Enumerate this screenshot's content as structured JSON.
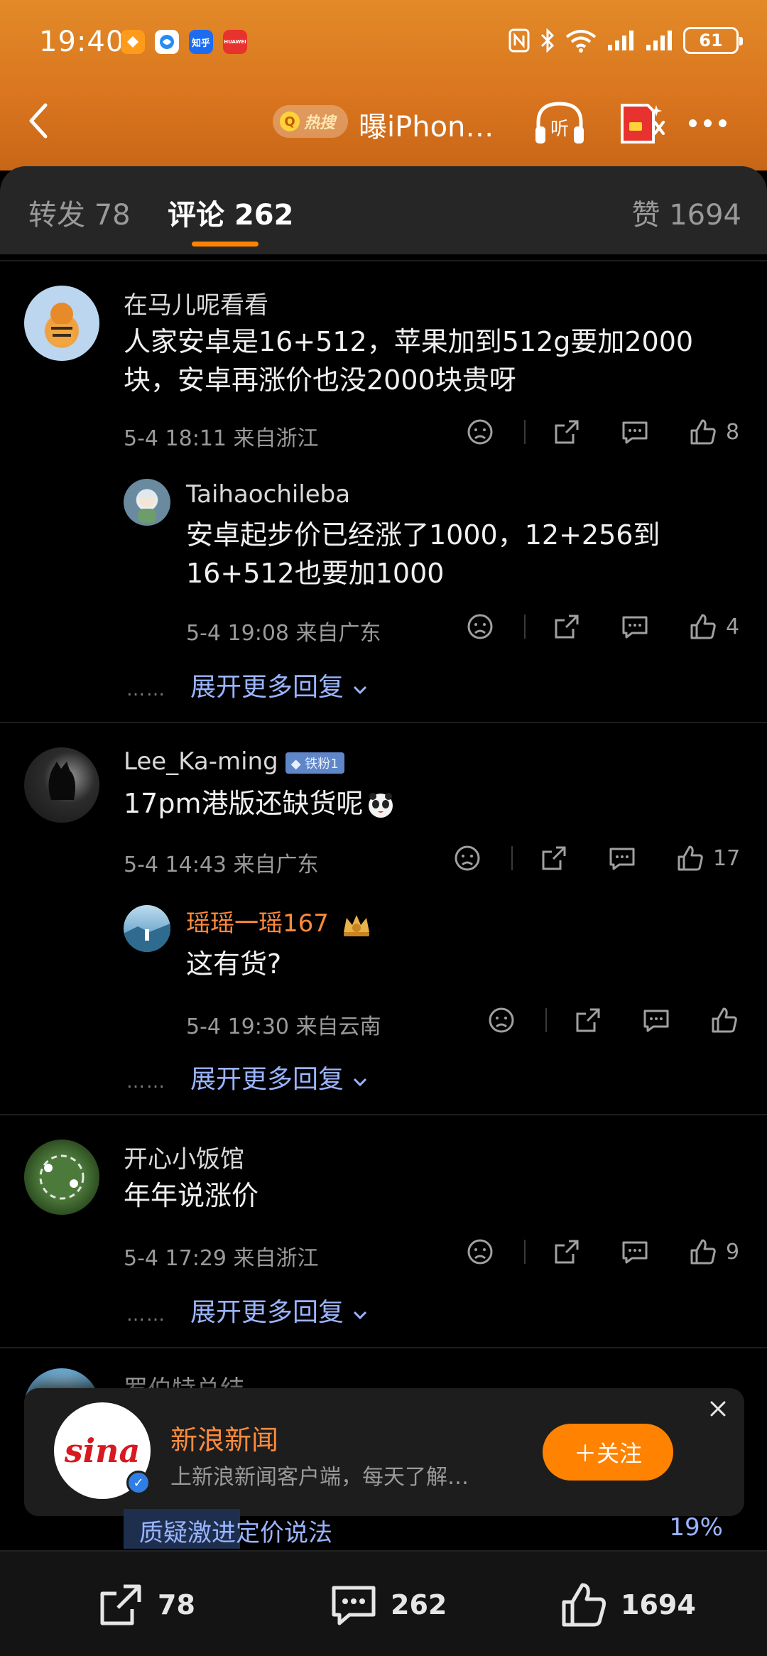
{
  "status": {
    "time": "19:40",
    "battery": "61",
    "app_icons": [
      "知乎",
      "HUAWEI"
    ]
  },
  "nav": {
    "hot_label": "热搜",
    "title": "曝iPhon…",
    "listen_label": "听"
  },
  "tabs": [
    {
      "label": "转发",
      "count": "78"
    },
    {
      "label": "评论",
      "count": "262"
    }
  ],
  "like_tab": {
    "label": "赞",
    "count": "1694"
  },
  "comments": [
    {
      "user": "在马儿呢看看",
      "text": "人家安卓是16+512，苹果加到512g要加2000块，安卓再涨价也没2000块贵呀",
      "time": "5-4 18:11",
      "location": "来自浙江",
      "likes": "8",
      "reply": {
        "user": "Taihaochileba",
        "text": "安卓起步价已经涨了1000，12+256到16+512也要加1000",
        "time": "5-4 19:08",
        "location": "来自广东",
        "likes": "4"
      },
      "expand": "展开更多回复"
    },
    {
      "user": "Lee_Ka-ming",
      "badge": "铁粉1",
      "text": "17pm港版还缺货呢",
      "time": "5-4 14:43",
      "location": "来自广东",
      "likes": "17",
      "reply": {
        "user": "瑶瑶一瑶167",
        "text": "这有货?",
        "time": "5-4 19:30",
        "location": "来自云南",
        "likes": ""
      },
      "expand": "展开更多回复"
    },
    {
      "user": "开心小饭馆",
      "text": "年年说涨价",
      "time": "5-4 17:29",
      "location": "来自浙江",
      "likes": "9",
      "expand": "展开更多回复"
    },
    {
      "user": "罗伯特总结"
    }
  ],
  "expand_dots": "……",
  "popup": {
    "logo_text": "sina",
    "title": "新浪新闻",
    "desc": "上新浪新闻客户端，每天了解…",
    "follow_label": "＋关注"
  },
  "poll": {
    "label": "质疑激进定价说法",
    "percent": "19%",
    "value": 0.19
  },
  "bottom": {
    "repost": "78",
    "comment": "262",
    "like": "1694"
  },
  "colors": {
    "accent": "#ff8200",
    "link": "#9ab4ff",
    "header": "#e38a28"
  }
}
